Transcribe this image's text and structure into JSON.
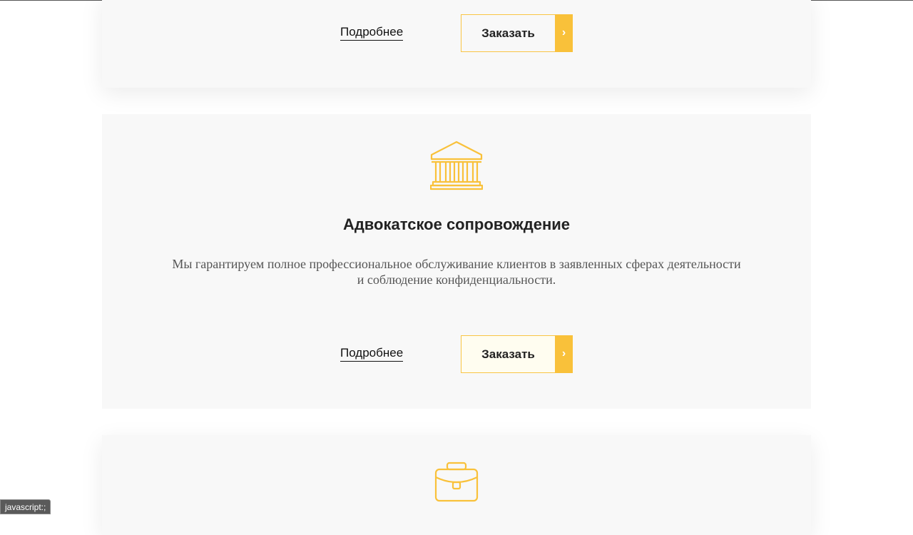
{
  "cards": [
    {
      "more_label": "Подробнее",
      "order_label": "Заказать",
      "arrow": "›"
    },
    {
      "icon": "courthouse-icon",
      "title": "Адвокатское сопровождение",
      "description_line1": "Мы гарантируем полное профессиональное обслуживание клиентов в заявленных сферах деятельности",
      "description_line2": "и соблюдение конфиденциальности.",
      "more_label": "Подробнее",
      "order_label": "Заказать",
      "arrow": "›"
    },
    {
      "icon": "briefcase-icon"
    }
  ],
  "status_bar": "javascript:;",
  "colors": {
    "accent": "#f9c13a",
    "card_bg": "#f8f8f8",
    "text_dark": "#222222",
    "text_muted": "#555555"
  }
}
